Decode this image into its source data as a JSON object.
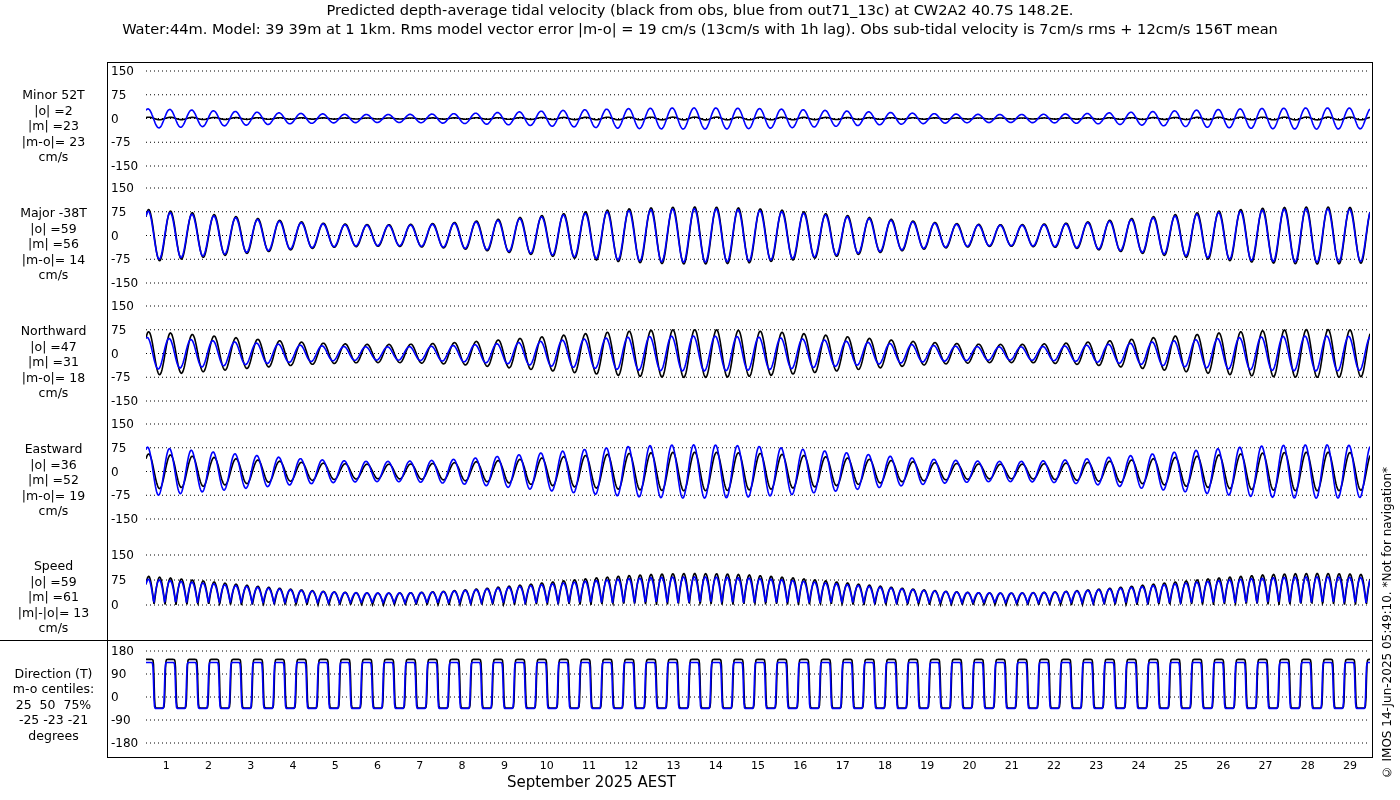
{
  "title_lines": [
    "Predicted depth-average tidal velocity (black from obs, blue from out71_13c) at CW2A2 40.7S 148.2E.",
    "Water:44m. Model: 39 39m at 1 1km. Rms model vector error |m-o| = 19 cm/s (13cm/s with 1h lag). Obs sub-tidal velocity is 7cm/s rms + 12cm/s 156T mean"
  ],
  "panels": [
    {
      "kind": "signed",
      "label_lines": [
        "Minor 52T",
        "|o| =2",
        "|m| =23",
        "|m-o|= 23",
        "cm/s"
      ],
      "yticks": [
        "150",
        "75",
        "0",
        "-75",
        "-150"
      ]
    },
    {
      "kind": "signed",
      "label_lines": [
        "Major -38T",
        "|o| =59",
        "|m| =56",
        "|m-o|= 14",
        "cm/s"
      ],
      "yticks": [
        "150",
        "75",
        "0",
        "-75",
        "-150"
      ]
    },
    {
      "kind": "signed",
      "label_lines": [
        "Northward",
        "|o| =47",
        "|m| =31",
        "|m-o|= 18",
        "cm/s"
      ],
      "yticks": [
        "150",
        "75",
        "0",
        "-75",
        "-150"
      ]
    },
    {
      "kind": "signed",
      "label_lines": [
        "Eastward",
        "|o| =36",
        "|m| =52",
        "|m-o|= 19",
        "cm/s"
      ],
      "yticks": [
        "150",
        "75",
        "0",
        "-75",
        "-150"
      ]
    },
    {
      "kind": "speed",
      "label_lines": [
        "Speed",
        "|o| =59",
        "|m| =61",
        "|m|-|o|= 13",
        "cm/s"
      ],
      "yticks": [
        "150",
        "75",
        "0"
      ]
    },
    {
      "kind": "direction",
      "label_lines": [
        "Direction (T)",
        "m-o centiles:",
        "25  50  75%",
        "-25 -23 -21",
        "degrees"
      ],
      "yticks": [
        "180",
        "90",
        "0",
        "-90",
        "-180"
      ]
    }
  ],
  "xticks": [
    "1",
    "2",
    "3",
    "4",
    "5",
    "6",
    "7",
    "8",
    "9",
    "10",
    "11",
    "12",
    "13",
    "14",
    "15",
    "16",
    "17",
    "18",
    "19",
    "20",
    "21",
    "22",
    "23",
    "24",
    "25",
    "26",
    "27",
    "28",
    "29"
  ],
  "xlabel": "September 2025 AEST",
  "side_note": "© IMOS 14-Jun-2025 05:49:10. *Not for navigation*"
}
